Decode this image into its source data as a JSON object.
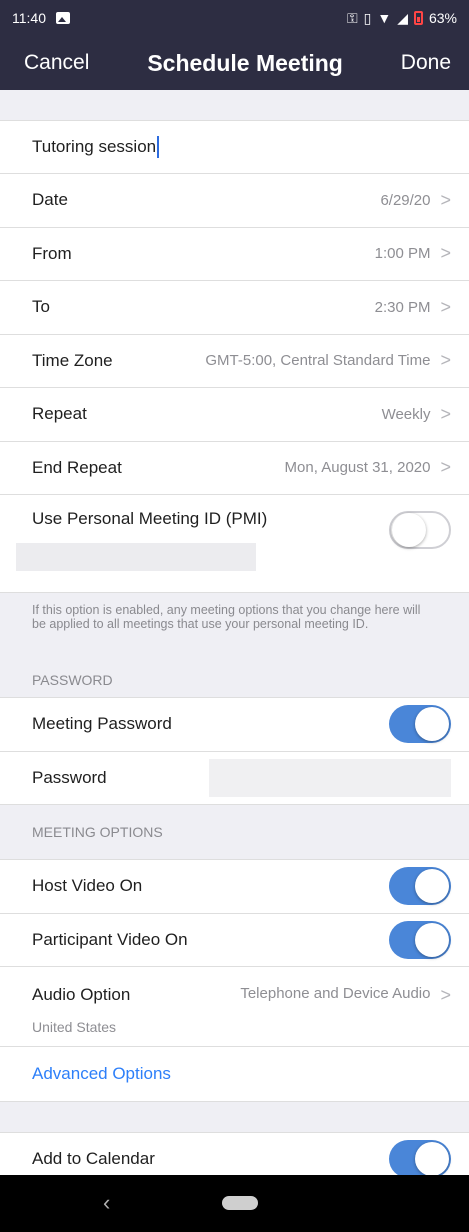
{
  "status_bar": {
    "time": "11:40",
    "battery": "63%"
  },
  "nav": {
    "cancel": "Cancel",
    "title": "Schedule Meeting",
    "done": "Done"
  },
  "topic": {
    "value": "Tutoring session"
  },
  "schedule": [
    {
      "label": "Date",
      "value": "6/29/20"
    },
    {
      "label": "From",
      "value": "1:00 PM"
    },
    {
      "label": "To",
      "value": "2:30 PM"
    },
    {
      "label": "Time Zone",
      "value": "GMT-5:00, Central Standard Time"
    },
    {
      "label": "Repeat",
      "value": "Weekly"
    },
    {
      "label": "End Repeat",
      "value": "Mon, August 31, 2020"
    }
  ],
  "pmi": {
    "label": "Use Personal Meeting ID (PMI)",
    "enabled": false
  },
  "pmi_note": "If this option is enabled, any meeting options that you change here will be applied to all meetings that use your personal meeting ID.",
  "password_section": {
    "header": "PASSWORD",
    "meeting_password_label": "Meeting Password",
    "meeting_password_enabled": true,
    "password_label": "Password"
  },
  "options_section": {
    "header": "MEETING OPTIONS",
    "host_video_label": "Host Video On",
    "host_video_enabled": true,
    "participant_video_label": "Participant Video On",
    "participant_video_enabled": true,
    "audio_label": "Audio Option",
    "audio_value": "Telephone and Device Audio",
    "audio_sub": "United States",
    "advanced_label": "Advanced Options"
  },
  "calendar": {
    "label": "Add to Calendar",
    "enabled": true
  },
  "icons": {
    "back": "‹"
  }
}
